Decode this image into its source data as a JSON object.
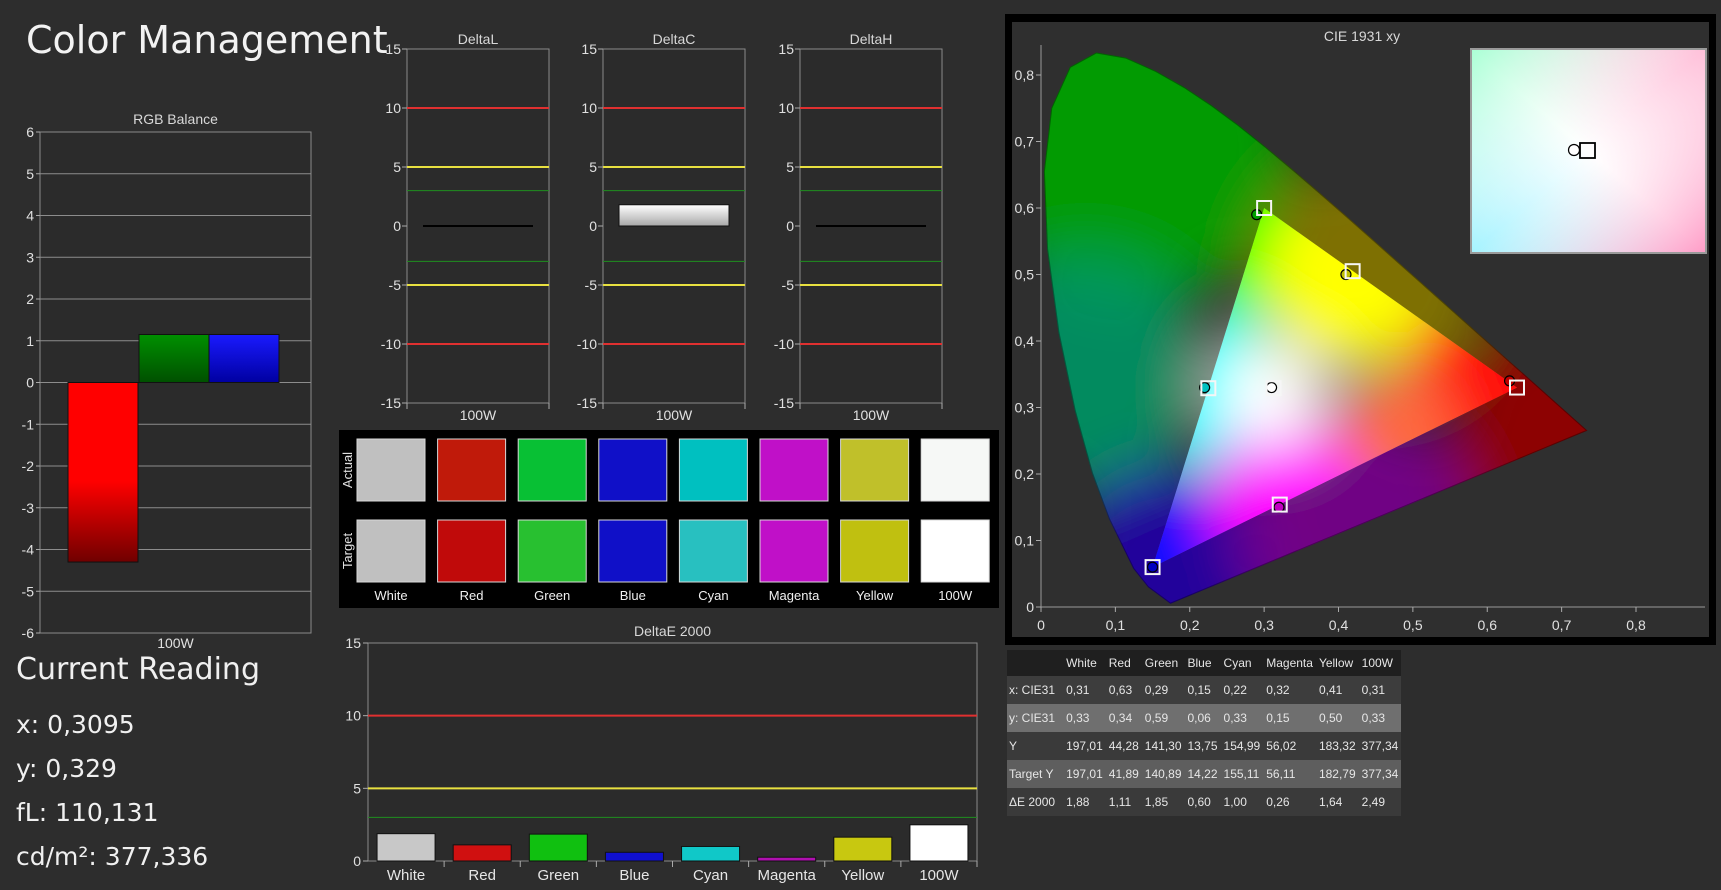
{
  "app": {
    "title": "Color Management"
  },
  "colors": {
    "background": "#2d2d2d",
    "plot_bg": "#2b2b2b",
    "red_line": "#e03030",
    "yellow_line": "#e8e040",
    "green_line": "#1f8f1f"
  },
  "chart_data": [
    {
      "id": "rgb_balance",
      "type": "bar",
      "title": "RGB Balance",
      "categories": [
        "100W"
      ],
      "ylim": [
        -6,
        6
      ],
      "yticks": [
        6,
        5,
        4,
        3,
        2,
        1,
        0,
        -1,
        -2,
        -3,
        -4,
        -5,
        -6
      ],
      "series": [
        {
          "color": "#ff0000",
          "values": [
            -4.3
          ]
        },
        {
          "color": "#007a00",
          "values": [
            1.15
          ]
        },
        {
          "color": "#1010ff",
          "values": [
            1.15
          ]
        }
      ],
      "grid": true
    },
    {
      "id": "delta_l",
      "type": "bar",
      "title": "DeltaL",
      "categories": [
        "100W"
      ],
      "ylim": [
        -15,
        15
      ],
      "yticks": [
        15,
        10,
        5,
        0,
        -5,
        -10,
        -15
      ],
      "values": [
        0.0
      ],
      "reference_lines": [
        10,
        5,
        3,
        -3,
        -5,
        -10
      ]
    },
    {
      "id": "delta_c",
      "type": "bar",
      "title": "DeltaC",
      "categories": [
        "100W"
      ],
      "ylim": [
        -15,
        15
      ],
      "yticks": [
        15,
        10,
        5,
        0,
        -5,
        -10,
        -15
      ],
      "values": [
        1.8
      ],
      "reference_lines": [
        10,
        5,
        3,
        -3,
        -5,
        -10
      ]
    },
    {
      "id": "delta_h",
      "type": "bar",
      "title": "DeltaH",
      "categories": [
        "100W"
      ],
      "ylim": [
        -15,
        15
      ],
      "yticks": [
        15,
        10,
        5,
        0,
        -5,
        -10,
        -15
      ],
      "values": [
        0.0
      ],
      "reference_lines": [
        10,
        5,
        3,
        -3,
        -5,
        -10
      ]
    },
    {
      "id": "swatches",
      "type": "table",
      "row_labels": [
        "Actual",
        "Target"
      ],
      "categories": [
        "White",
        "Red",
        "Green",
        "Blue",
        "Cyan",
        "Magenta",
        "Yellow",
        "100W"
      ],
      "actual": [
        "#c0c0c0",
        "#c01a0a",
        "#08c034",
        "#1010c8",
        "#00c0c0",
        "#c010c8",
        "#c0c02a",
        "#f6f8f6"
      ],
      "target": [
        "#c0c0c0",
        "#c00a0a",
        "#28c030",
        "#1010c8",
        "#28c0c0",
        "#c010c8",
        "#c0c010",
        "#ffffff"
      ]
    },
    {
      "id": "delta_e_2000",
      "type": "bar",
      "title": "DeltaE 2000",
      "categories": [
        "White",
        "Red",
        "Green",
        "Blue",
        "Cyan",
        "Magenta",
        "Yellow",
        "100W"
      ],
      "values": [
        1.88,
        1.11,
        1.85,
        0.6,
        1.0,
        0.26,
        1.64,
        2.49
      ],
      "bar_colors": [
        "#c8c8c8",
        "#d01010",
        "#10c010",
        "#1010d0",
        "#10c8c8",
        "#b010b0",
        "#c8c810",
        "#ffffff"
      ],
      "ylim": [
        0,
        15
      ],
      "yticks": [
        15,
        10,
        5,
        0
      ],
      "reference_lines": [
        10,
        5,
        3
      ]
    },
    {
      "id": "cie_1931_xy",
      "type": "scatter",
      "title": "CIE 1931 xy",
      "xlim": [
        0,
        0.8
      ],
      "ylim": [
        0,
        0.85
      ],
      "xticks": [
        "0",
        "0,1",
        "0,2",
        "0,3",
        "0,4",
        "0,5",
        "0,6",
        "0,7",
        "0,8"
      ],
      "yticks": [
        "0",
        "0,1",
        "0,2",
        "0,3",
        "0,4",
        "0,5",
        "0,6",
        "0,7",
        "0,8"
      ],
      "targets": [
        {
          "x": 0.64,
          "y": 0.33
        },
        {
          "x": 0.3,
          "y": 0.6
        },
        {
          "x": 0.15,
          "y": 0.06
        },
        {
          "x": 0.225,
          "y": 0.329
        },
        {
          "x": 0.321,
          "y": 0.154
        },
        {
          "x": 0.419,
          "y": 0.505
        },
        {
          "x": 0.3127,
          "y": 0.329
        }
      ],
      "measured": [
        {
          "x": 0.63,
          "y": 0.34,
          "color": "#c00000"
        },
        {
          "x": 0.29,
          "y": 0.59,
          "color": "#00a000"
        },
        {
          "x": 0.15,
          "y": 0.06,
          "color": "#0000c0"
        },
        {
          "x": 0.22,
          "y": 0.33,
          "color": "#00c0c0"
        },
        {
          "x": 0.32,
          "y": 0.15,
          "color": "#c000c0"
        },
        {
          "x": 0.41,
          "y": 0.5,
          "color": "#c0c000"
        },
        {
          "x": 0.31,
          "y": 0.33,
          "color": "#ffffff"
        }
      ]
    }
  ],
  "current_reading": {
    "title": "Current Reading",
    "x": "x: 0,3095",
    "y": "y: 0,329",
    "fl": "fL: 110,131",
    "cdm2": "cd/m²: 377,336"
  },
  "data_table": {
    "columns": [
      "",
      "White",
      "Red",
      "Green",
      "Blue",
      "Cyan",
      "Magenta",
      "Yellow",
      "100W"
    ],
    "rows": [
      [
        "x: CIE31",
        "0,31",
        "0,63",
        "0,29",
        "0,15",
        "0,22",
        "0,32",
        "0,41",
        "0,31"
      ],
      [
        "y: CIE31",
        "0,33",
        "0,34",
        "0,59",
        "0,06",
        "0,33",
        "0,15",
        "0,50",
        "0,33"
      ],
      [
        "Y",
        "197,01",
        "44,28",
        "141,30",
        "13,75",
        "154,99",
        "56,02",
        "183,32",
        "377,34"
      ],
      [
        "Target Y",
        "197,01",
        "41,89",
        "140,89",
        "14,22",
        "155,11",
        "56,11",
        "182,79",
        "377,34"
      ],
      [
        "ΔE 2000",
        "1,88",
        "1,11",
        "1,85",
        "0,60",
        "1,00",
        "0,26",
        "1,64",
        "2,49"
      ]
    ]
  }
}
